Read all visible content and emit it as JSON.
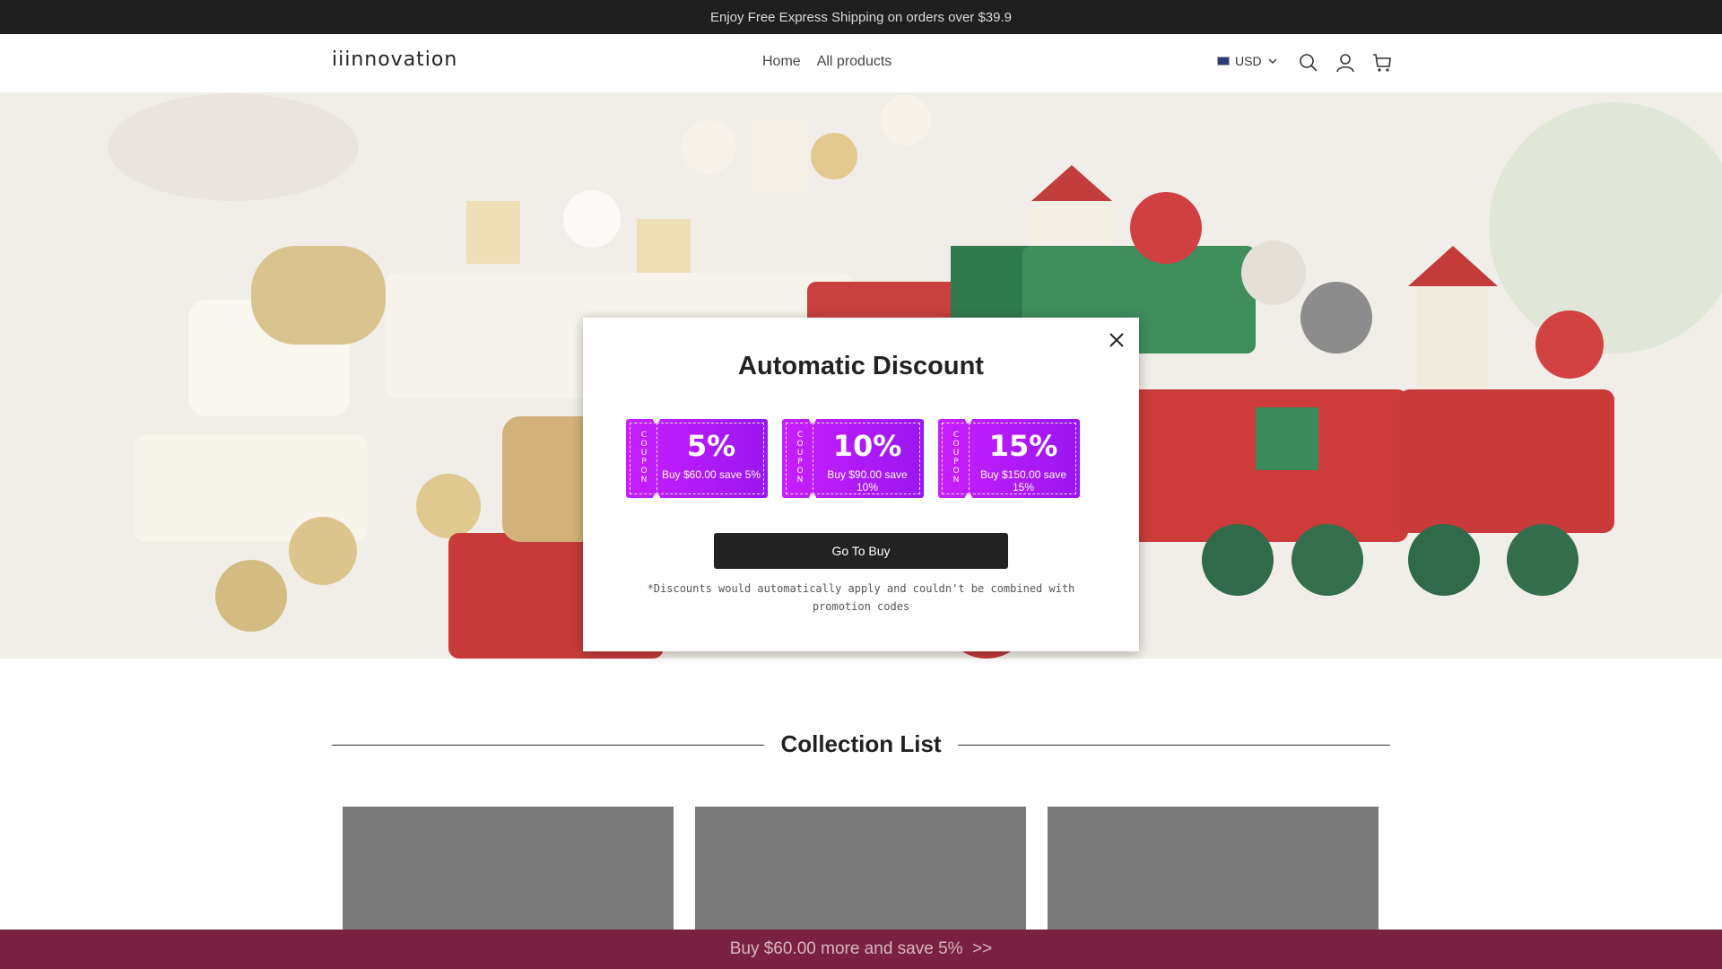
{
  "announcement": {
    "text": "Enjoy Free Express Shipping on orders over $39.9"
  },
  "header": {
    "logo": "iiinnovation",
    "nav": [
      "Home",
      "All products"
    ],
    "currency": "USD"
  },
  "modal": {
    "title": "Automatic Discount",
    "coupons": [
      {
        "side_label": "COUPON",
        "percent": "5%",
        "desc": "Buy $60.00 save 5%"
      },
      {
        "side_label": "COUPON",
        "percent": "10%",
        "desc": "Buy $90.00 save 10%"
      },
      {
        "side_label": "COUPON",
        "percent": "15%",
        "desc": "Buy $150.00 save 15%"
      }
    ],
    "button_label": "Go To Buy",
    "note": "*Discounts would automatically apply and couldn't be combined with promotion codes"
  },
  "collection": {
    "title": "Collection List"
  },
  "sticky_bar": {
    "text": "Buy $60.00 more and save 5%  >>"
  },
  "colors": {
    "announcement_bg": "#1f1f1f",
    "coupon_gradient_start": "#c81fff",
    "coupon_gradient_end": "#9a16f0",
    "button_bg": "#222222",
    "sticky_bg": "#7a2141"
  },
  "icons": [
    "search-icon",
    "account-icon",
    "cart-icon",
    "close-icon",
    "chevron-down-icon"
  ]
}
